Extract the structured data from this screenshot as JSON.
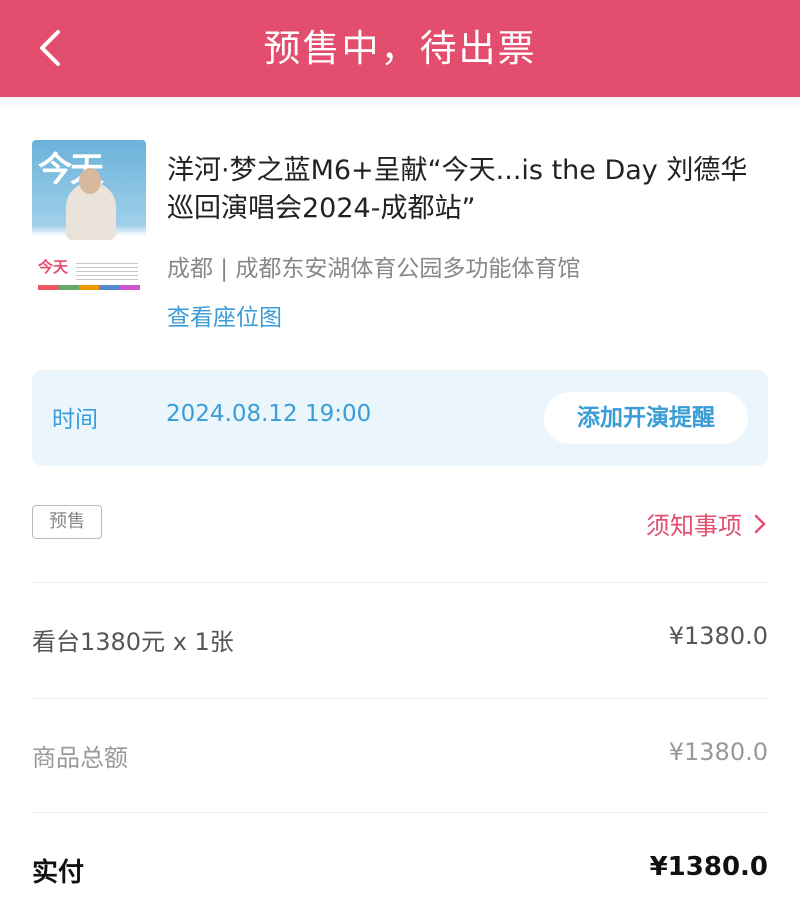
{
  "header": {
    "title": "预售中，待出票"
  },
  "poster": {
    "top_text": "今天",
    "bottom_text": "今天"
  },
  "event": {
    "title": "洋河·梦之蓝M6+呈献“今天...is the Day 刘德华巡回演唱会2024-成都站”",
    "venue": "成都 | 成都东安湖体育公园多功能体育馆",
    "seat_map_link": "查看座位图"
  },
  "time_card": {
    "label": "时间",
    "value": "2024.08.12 19:00",
    "remind_button": "添加开演提醒"
  },
  "status": {
    "badge": "预售",
    "notice_link": "须知事项"
  },
  "order": {
    "ticket_desc": "看台1380元 x 1张",
    "ticket_price": "¥1380.0",
    "subtotal_label": "商品总额",
    "subtotal_value": "¥1380.0",
    "paid_label": "实付",
    "paid_value": "¥1380.0"
  },
  "colors": {
    "brand": "#e34d6e",
    "link": "#3a9dd6",
    "card_bg": "#eaf5fc"
  }
}
